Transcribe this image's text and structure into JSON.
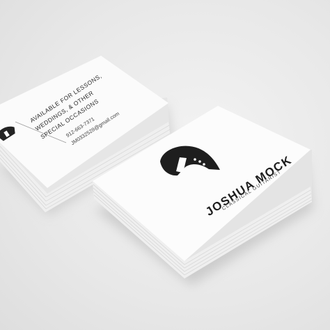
{
  "back_card": {
    "tagline": [
      "AVAILABLE FOR LESSONS,",
      "WEDDINGS, & OTHER",
      "SPECIAL OCCASIONS"
    ],
    "phone": "912-663-7371",
    "email": "JM0332528@gmail.com"
  },
  "front_card": {
    "name": "JOSHUA MOCK",
    "subtitle": "CLASSICAL GUITARIST",
    "logo_icon": "guitar-headstock-icon"
  },
  "colors": {
    "background": "#ececec",
    "card": "#fafafa",
    "ink": "#222222"
  }
}
